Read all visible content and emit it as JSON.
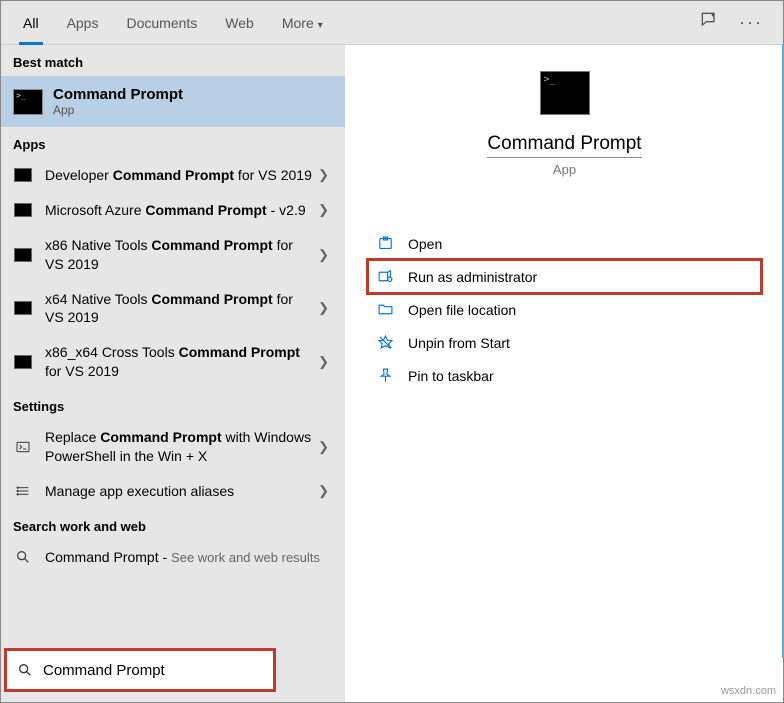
{
  "tabs": [
    "All",
    "Apps",
    "Documents",
    "Web",
    "More"
  ],
  "active_tab": "All",
  "sections": {
    "best_match": "Best match",
    "apps": "Apps",
    "settings": "Settings",
    "search_web": "Search work and web"
  },
  "best_match_item": {
    "title": "Command Prompt",
    "subtitle": "App"
  },
  "apps_items": [
    {
      "pre": "Developer ",
      "bold": "Command Prompt",
      "post": " for VS 2019"
    },
    {
      "pre": "Microsoft Azure ",
      "bold": "Command Prompt",
      "post": " - v2.9"
    },
    {
      "pre": "x86 Native Tools ",
      "bold": "Command Prompt",
      "post": " for VS 2019"
    },
    {
      "pre": "x64 Native Tools ",
      "bold": "Command Prompt",
      "post": " for VS 2019"
    },
    {
      "pre": "x86_x64 Cross Tools ",
      "bold": "Command Prompt",
      "post": " for VS 2019"
    }
  ],
  "settings_items": [
    {
      "pre": "Replace ",
      "bold": "Command Prompt",
      "post": " with Windows PowerShell in the Win + X",
      "icon": "powershell"
    },
    {
      "pre": "Manage app execution aliases",
      "bold": "",
      "post": "",
      "icon": "aliases"
    }
  ],
  "web_item": {
    "title": "Command Prompt",
    "hint": "See work and web results"
  },
  "preview": {
    "title": "Command Prompt",
    "subtitle": "App"
  },
  "actions": [
    {
      "label": "Open",
      "icon": "open"
    },
    {
      "label": "Run as administrator",
      "icon": "admin",
      "highlighted": true
    },
    {
      "label": "Open file location",
      "icon": "folder"
    },
    {
      "label": "Unpin from Start",
      "icon": "unpin"
    },
    {
      "label": "Pin to taskbar",
      "icon": "pin"
    }
  ],
  "search_value": "Command Prompt",
  "watermark": "wsxdn.com"
}
